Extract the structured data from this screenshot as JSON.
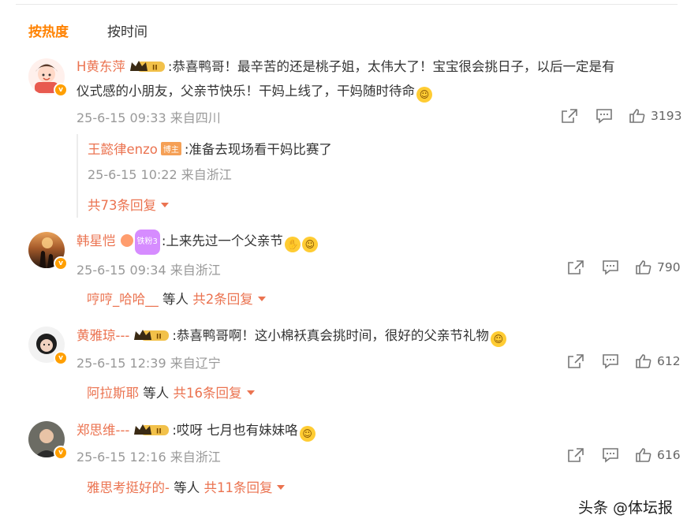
{
  "tabs": {
    "hot": "按热度",
    "time": "按时间"
  },
  "colors": {
    "accent": "#ff8200",
    "username": "#eb7350",
    "meta": "#999999"
  },
  "comments": [
    {
      "user": "H黄东萍",
      "text_line1": ":恭喜鸭哥！最辛苦的还是桃子姐，太伟大了！宝宝很会挑日子，以后一定是有",
      "text_line2": "仪式感的小朋友，父亲节快乐！干妈上线了，干妈随时待命",
      "meta": "25-6-15 09:33 来自四川",
      "likes": "3193",
      "reply": {
        "user": "王懿律enzo",
        "badge": "博主",
        "text": ":准备去现场看干妈比赛了",
        "meta": "25-6-15 10:22 来自浙江"
      },
      "more": "共73条回复"
    },
    {
      "user": "韩星恺",
      "fan_badge": "铁粉3",
      "text": ":上来先过一个父亲节",
      "meta": "25-6-15 09:34 来自浙江",
      "likes": "790",
      "more_user": "哼哼_哈哈__",
      "more_mid": "等人",
      "more": "共2条回复"
    },
    {
      "user": "黄雅琼---",
      "text": ":恭喜鸭哥啊！这小棉袄真会挑时间，很好的父亲节礼物",
      "meta": "25-6-15 12:39 来自辽宁",
      "likes": "612",
      "more_user": "阿拉斯耶",
      "more_mid": "等人",
      "more": "共16条回复"
    },
    {
      "user": "郑思维---",
      "text": ":哎呀 七月也有妹妹咯",
      "meta": "25-6-15 12:16 来自浙江",
      "likes": "616",
      "more_user": "雅思考挺好的-",
      "more_mid": "等人",
      "more": "共11条回复"
    }
  ],
  "icons": [
    "share-icon",
    "comment-icon",
    "like-icon",
    "vip-crown-icon",
    "verified-badge-icon"
  ],
  "watermark": "头条 @体坛报"
}
